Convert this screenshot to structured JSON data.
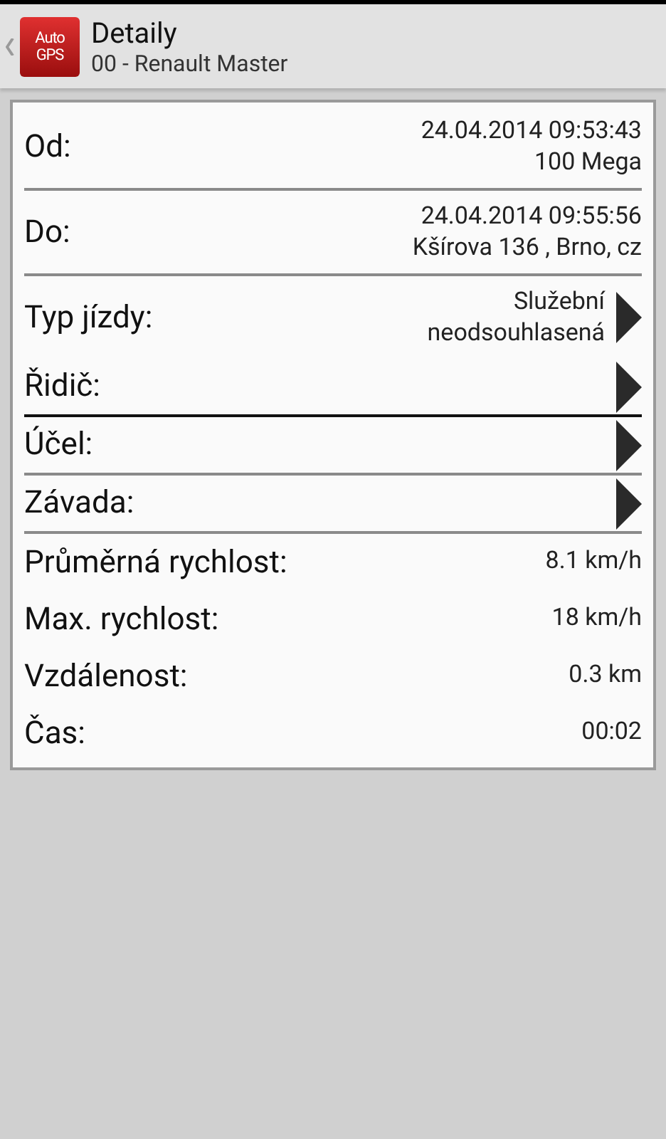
{
  "header": {
    "logo": [
      "Auto",
      "GPS"
    ],
    "title": "Detaily",
    "subtitle": "00 - Renault Master"
  },
  "rows": [
    {
      "kind": "info",
      "label": "Od:",
      "values": [
        "24.04.2014 09:53:43",
        "100 Mega"
      ],
      "divided": true,
      "strong": false
    },
    {
      "kind": "info",
      "label": "Do:",
      "values": [
        "24.04.2014 09:55:56",
        "Kšírova 136 , Brno, cz"
      ],
      "divided": true,
      "strong": false
    },
    {
      "kind": "nav",
      "label": "Typ jízdy:",
      "values": [
        "Služební",
        "neodsouhlasená"
      ],
      "divided": false
    },
    {
      "kind": "nav",
      "label": "Řidič:",
      "divided": true,
      "strong": true
    },
    {
      "kind": "nav",
      "label": "Účel:",
      "divided": true,
      "strong": false
    },
    {
      "kind": "nav",
      "label": "Závada:",
      "divided": true,
      "strong": false
    },
    {
      "kind": "stat",
      "label": "Průměrná rychlost:",
      "values": [
        "8.1 km/h"
      ]
    },
    {
      "kind": "stat",
      "label": "Max. rychlost:",
      "values": [
        "18 km/h"
      ]
    },
    {
      "kind": "stat",
      "label": "Vzdálenost:",
      "values": [
        "0.3 km"
      ]
    },
    {
      "kind": "stat",
      "label": "Čas:",
      "values": [
        "00:02"
      ]
    }
  ]
}
